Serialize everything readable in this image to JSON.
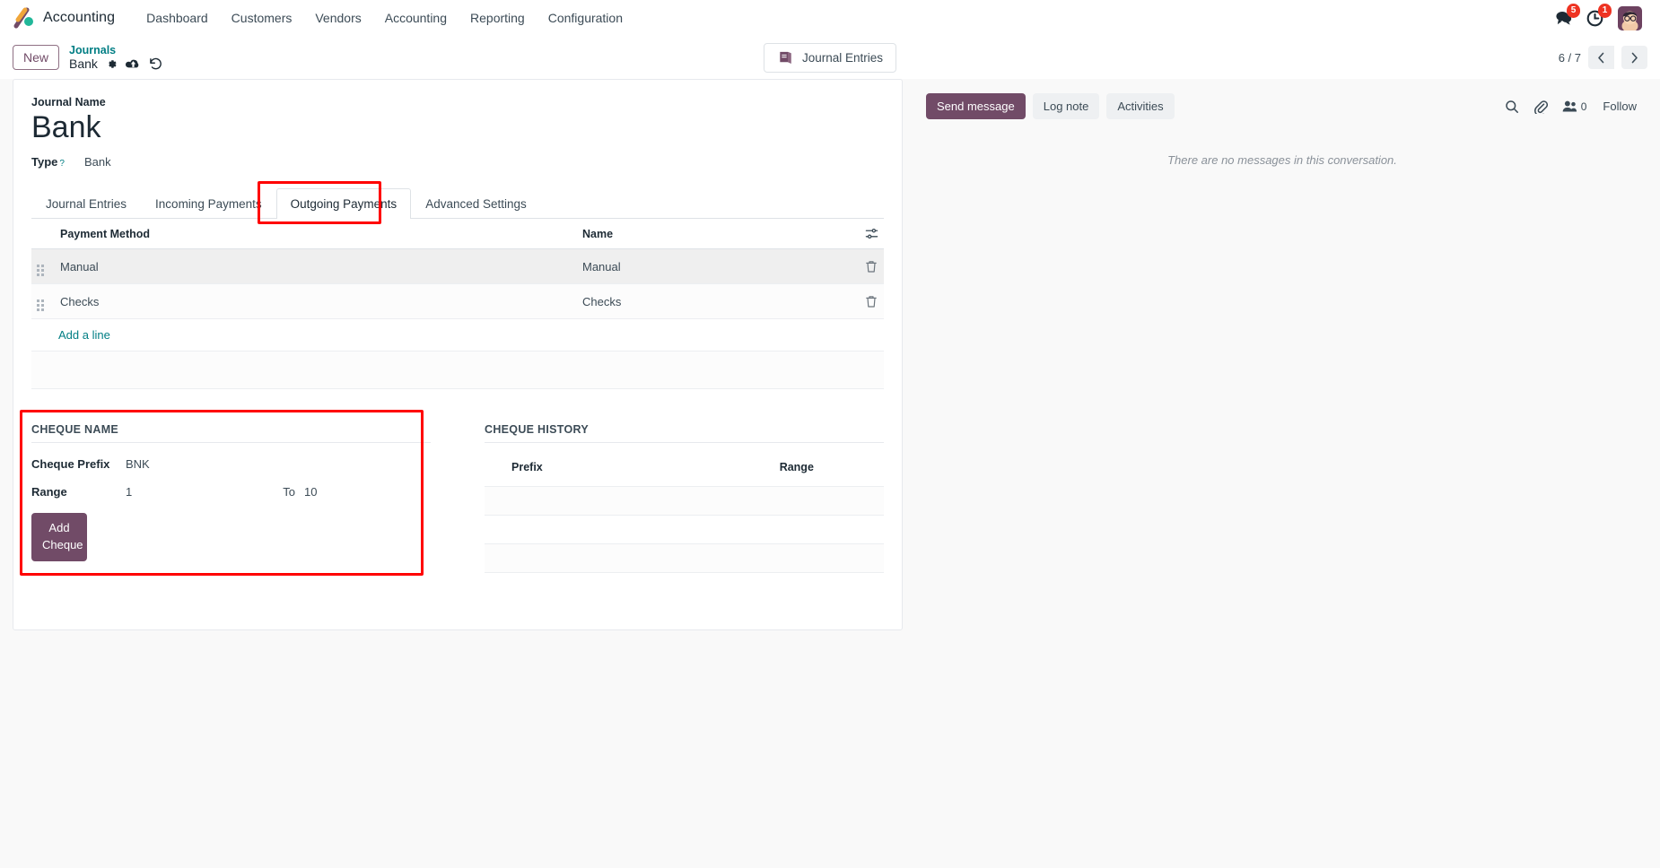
{
  "navbar": {
    "brand": "Accounting",
    "logo_icon": "odoo-logo-icon",
    "menu": [
      {
        "label": "Dashboard"
      },
      {
        "label": "Customers"
      },
      {
        "label": "Vendors"
      },
      {
        "label": "Accounting"
      },
      {
        "label": "Reporting"
      },
      {
        "label": "Configuration"
      }
    ],
    "systray": {
      "messages_icon": "messages-icon",
      "messages_count": "5",
      "activities_icon": "clock-activities-icon",
      "activities_count": "1",
      "avatar_icon": "user-avatar"
    }
  },
  "control_panel": {
    "new_button": "New",
    "breadcrumb_parent": "Journals",
    "breadcrumb_current": "Bank",
    "settings_icon": "gear-icon",
    "save_icon": "cloud-upload-icon",
    "discard_icon": "undo-icon",
    "smart_button": {
      "label": "Journal Entries",
      "icon": "book-icon"
    },
    "pager": {
      "text": "6 / 7",
      "prev_icon": "chevron-left-icon",
      "next_icon": "chevron-right-icon"
    }
  },
  "form": {
    "journal_name_label": "Journal Name",
    "journal_name_value": "Bank",
    "type_label": "Type",
    "type_help": "?",
    "type_value": "Bank",
    "tabs": [
      {
        "label": "Journal Entries",
        "active": false
      },
      {
        "label": "Incoming Payments",
        "active": false
      },
      {
        "label": "Outgoing Payments",
        "active": true
      },
      {
        "label": "Advanced Settings",
        "active": false
      }
    ],
    "payment_methods": {
      "columns": [
        "Payment Method",
        "Name"
      ],
      "rows": [
        {
          "payment_method": "Manual",
          "name": "Manual"
        },
        {
          "payment_method": "Checks",
          "name": "Checks"
        }
      ],
      "add_line_label": "Add a line",
      "drag_icon": "drag-handle-icon",
      "delete_icon": "trash-icon",
      "optional_columns_icon": "optional-columns-icon"
    },
    "cheque_name": {
      "title": "Cheque Name",
      "prefix_label": "Cheque Prefix",
      "prefix_value": "BNK",
      "range_label": "Range",
      "range_from": "1",
      "range_to_label": "To",
      "range_to": "10",
      "add_button": "Add Cheque"
    },
    "cheque_history": {
      "title": "Cheque History",
      "columns": [
        "Prefix",
        "Range"
      ],
      "rows": []
    }
  },
  "chatter": {
    "send_message": "Send message",
    "log_note": "Log note",
    "activities": "Activities",
    "search_icon": "search-icon",
    "attachment_icon": "paperclip-icon",
    "followers_icon": "followers-icon",
    "followers_count": "0",
    "follow_button": "Follow",
    "empty_message": "There are no messages in this conversation."
  },
  "colors": {
    "primary": "#714b67",
    "link": "#017e84",
    "highlight": "#ff0000",
    "badge": "#ee3322"
  }
}
